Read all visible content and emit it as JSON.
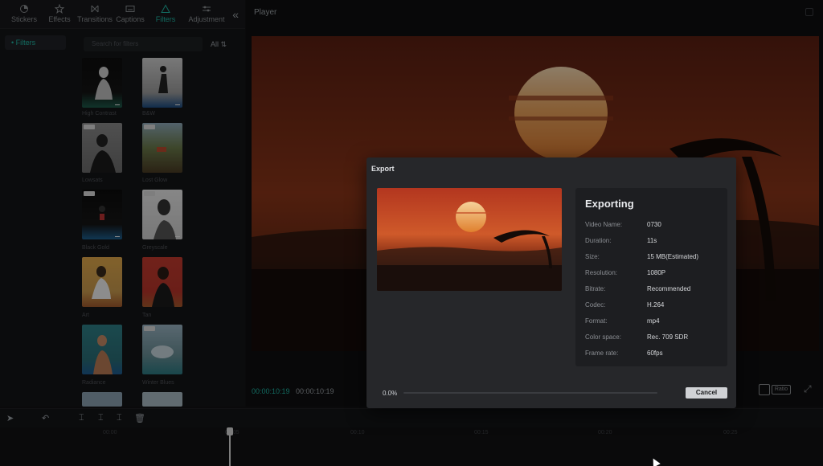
{
  "toolbar": {
    "items": [
      {
        "label": "Stickers",
        "icon": "sticker-icon"
      },
      {
        "label": "Effects",
        "icon": "effects-icon"
      },
      {
        "label": "Transitions",
        "icon": "transitions-icon"
      },
      {
        "label": "Captions",
        "icon": "captions-icon"
      },
      {
        "label": "Filters",
        "icon": "filters-icon"
      },
      {
        "label": "Adjustment",
        "icon": "adjustment-icon"
      }
    ],
    "active": "Filters",
    "collapse_glyph": "«"
  },
  "leftnav": {
    "item": "• Filters"
  },
  "filters": {
    "search_placeholder": "Search for filters",
    "all_label": "All",
    "thumbs": [
      {
        "label": "High Contrast"
      },
      {
        "label": "B&W"
      },
      {
        "label": "Lowsats"
      },
      {
        "label": "Lost Glow"
      },
      {
        "label": "Black Gold"
      },
      {
        "label": "Greyscale"
      },
      {
        "label": "Art"
      },
      {
        "label": "Tan"
      },
      {
        "label": "Radiance"
      },
      {
        "label": "Winter Blues"
      }
    ]
  },
  "player": {
    "title": "Player",
    "timecode_current": "00:00:10:19",
    "timecode_total": "00:00:10:19",
    "ratio_label": "Ratio"
  },
  "timeline": {
    "ruler": [
      "00:00",
      "00:05",
      "00:10",
      "00:15",
      "00:20",
      "00:25"
    ]
  },
  "export": {
    "title": "Export",
    "heading": "Exporting",
    "rows": [
      {
        "key": "Video Name:",
        "value": "0730"
      },
      {
        "key": "Duration:",
        "value": "11s"
      },
      {
        "key": "Size:",
        "value": "15 MB(Estimated)"
      },
      {
        "key": "Resolution:",
        "value": "1080P"
      },
      {
        "key": "Bitrate:",
        "value": "Recommended"
      },
      {
        "key": "Codec:",
        "value": "H.264"
      },
      {
        "key": "Format:",
        "value": "mp4"
      },
      {
        "key": "Color space:",
        "value": "Rec. 709 SDR"
      },
      {
        "key": "Frame rate:",
        "value": "60fps"
      }
    ],
    "progress_label": "0.0%",
    "progress_value": 0,
    "cancel_label": "Cancel"
  },
  "colors": {
    "accent": "#1fb7a6",
    "dialog_bg": "#26272a"
  }
}
